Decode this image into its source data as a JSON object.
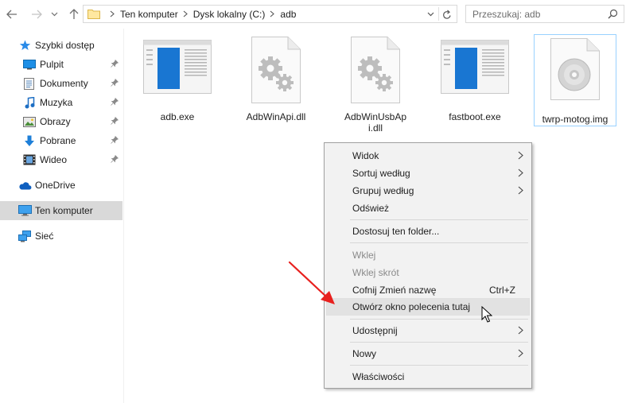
{
  "breadcrumbs": [
    "Ten komputer",
    "Dysk lokalny (C:)",
    "adb"
  ],
  "search": {
    "placeholder": "Przeszukaj: adb"
  },
  "sidebar": {
    "items": [
      {
        "label": "Szybki dostęp",
        "icon": "star-icon"
      },
      {
        "label": "Pulpit",
        "icon": "desktop-icon",
        "pinned": true
      },
      {
        "label": "Dokumenty",
        "icon": "documents-icon",
        "pinned": true
      },
      {
        "label": "Muzyka",
        "icon": "music-icon",
        "pinned": true
      },
      {
        "label": "Obrazy",
        "icon": "pictures-icon",
        "pinned": true
      },
      {
        "label": "Pobrane",
        "icon": "download-icon",
        "pinned": true
      },
      {
        "label": "Wideo",
        "icon": "video-icon",
        "pinned": true
      },
      {
        "label": "OneDrive",
        "icon": "cloud-icon"
      },
      {
        "label": "Ten komputer",
        "icon": "computer-icon",
        "selected": true
      },
      {
        "label": "Sieć",
        "icon": "network-icon"
      }
    ]
  },
  "files": [
    {
      "name": "adb.exe",
      "icon": "exe-icon"
    },
    {
      "name": "AdbWinApi.dll",
      "icon": "dll-gear-icon"
    },
    {
      "name": "AdbWinUsbApi.dll",
      "icon": "dll-gear-icon"
    },
    {
      "name": "fastboot.exe",
      "icon": "exe-icon"
    },
    {
      "name": "twrp-motog.img",
      "icon": "disc-image-icon",
      "selected": true
    }
  ],
  "context_menu": {
    "items": [
      {
        "label": "Widok",
        "submenu": true
      },
      {
        "label": "Sortuj według",
        "submenu": true
      },
      {
        "label": "Grupuj według",
        "submenu": true
      },
      {
        "label": "Odśwież"
      },
      {
        "label": "Dostosuj ten folder..."
      },
      {
        "label": "Wklej",
        "disabled": true
      },
      {
        "label": "Wklej skrót",
        "disabled": true
      },
      {
        "label": "Cofnij Zmień nazwę",
        "shortcut": "Ctrl+Z"
      },
      {
        "label": "Otwórz okno polecenia tutaj",
        "highlighted": true
      },
      {
        "label": "Udostępnij",
        "submenu": true
      },
      {
        "label": "Nowy",
        "submenu": true
      },
      {
        "label": "Właściwości"
      }
    ]
  },
  "colors": {
    "accent": "#0078d7",
    "annotation_arrow": "#e8201e",
    "menu_bg": "#f2f2f2",
    "selection": "#d9d9d9"
  }
}
